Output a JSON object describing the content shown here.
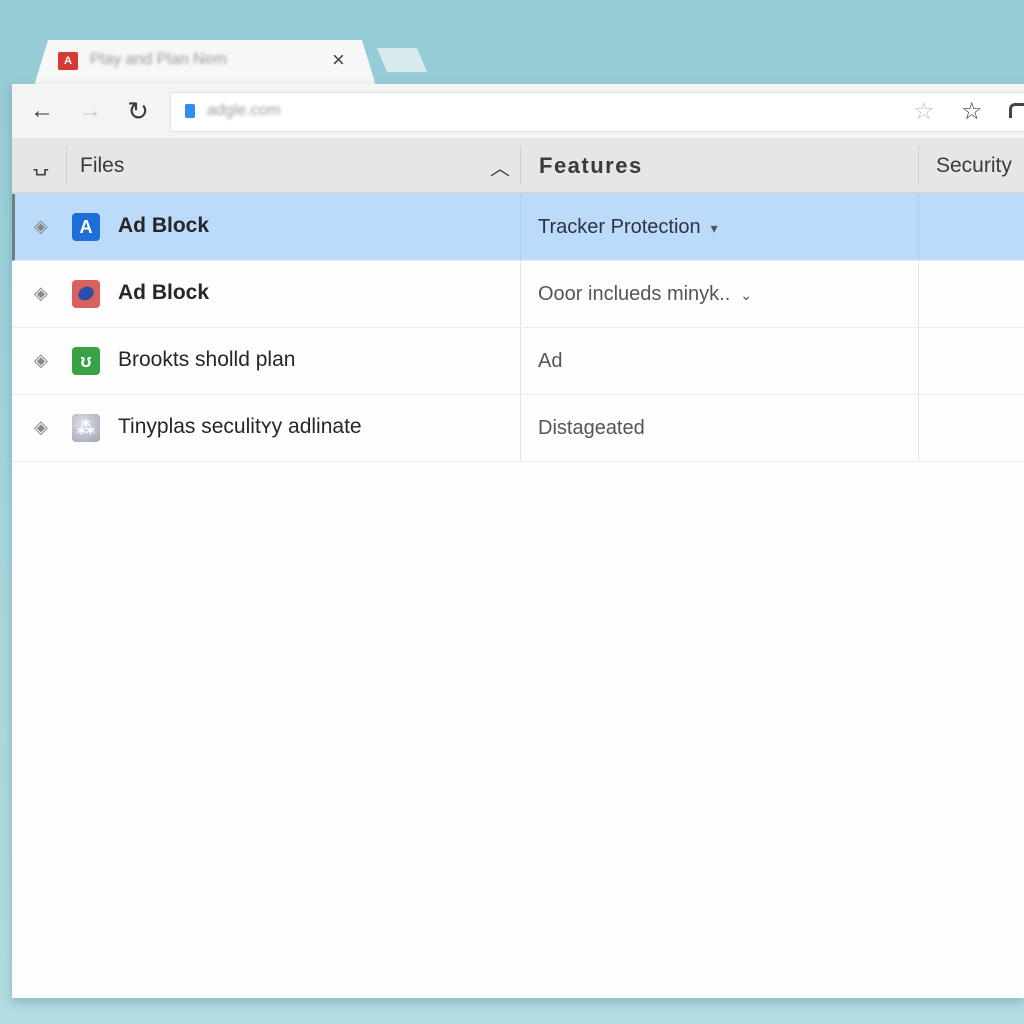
{
  "browser": {
    "tab": {
      "title": "Play and Plan Nem",
      "favicon": "app-favicon-icon",
      "favicon_glyph": "A",
      "close_glyph": "×"
    },
    "toolbar": {
      "back_glyph": "←",
      "forward_glyph": "→",
      "reload_glyph": "↻",
      "url": "adgle.com",
      "star_glyph": "☆"
    }
  },
  "table": {
    "header": {
      "handle_glyph": "⍽",
      "files": "Files",
      "sort_glyph": "︿",
      "features": "Features",
      "security": "Security"
    },
    "rows": [
      {
        "name": "Ad Block",
        "icon": "blue-a-app-icon",
        "icon_glyph": "A",
        "feature": "Tracker Protection",
        "feature_dropdown": "▾",
        "security": "",
        "selected": true
      },
      {
        "name": "Ad Block",
        "icon": "red-globe-app-icon",
        "icon_glyph": "",
        "feature": "Ooor inclueds minyk..",
        "feature_dropdown": "⌄",
        "security": "",
        "selected": false
      },
      {
        "name": "Brookts sholld plan",
        "icon": "green-shield-icon",
        "icon_glyph": "ʊ",
        "feature": "Ad",
        "feature_dropdown": "",
        "security": "",
        "selected": false
      },
      {
        "name": "Tinyplas seculitʏy adlinate",
        "icon": "gray-nodes-icon",
        "icon_glyph": "⁂",
        "feature": "Distageated",
        "feature_dropdown": "",
        "security": "",
        "selected": false
      }
    ],
    "row_marker_glyph": "◈"
  },
  "colors": {
    "selected_row": "#bcdaf9",
    "background": "#a9d6dd",
    "favicon": "#d63a35",
    "lock": "#2f8ef0"
  }
}
